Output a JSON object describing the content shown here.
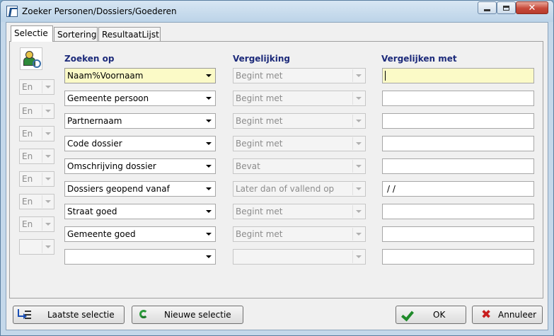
{
  "window": {
    "title": "Zoeker Personen/Dossiers/Goederen"
  },
  "tabs": [
    {
      "label": "Selectie",
      "active": true
    },
    {
      "label": "Sortering",
      "active": false
    },
    {
      "label": "ResultaatLijst",
      "active": false
    }
  ],
  "headers": {
    "field": "Zoeken op",
    "comparison": "Vergelijking",
    "value": "Vergelijken met"
  },
  "rows": [
    {
      "conj": "",
      "field": "Naam%Voornaam",
      "comparison": "Begint met",
      "value": ""
    },
    {
      "conj": "En",
      "field": "Gemeente persoon",
      "comparison": "Begint met",
      "value": ""
    },
    {
      "conj": "En",
      "field": "Partnernaam",
      "comparison": "Begint met",
      "value": ""
    },
    {
      "conj": "En",
      "field": "Code dossier",
      "comparison": "Begint met",
      "value": ""
    },
    {
      "conj": "En",
      "field": "Omschrijving dossier",
      "comparison": "Bevat",
      "value": ""
    },
    {
      "conj": "En",
      "field": "Dossiers geopend vanaf",
      "comparison": "Later dan of vallend op",
      "value": " /  /"
    },
    {
      "conj": "En",
      "field": "Straat goed",
      "comparison": "Begint met",
      "value": ""
    },
    {
      "conj": "En",
      "field": "Gemeente goed",
      "comparison": "Begint met",
      "value": ""
    },
    {
      "conj": "",
      "field": "",
      "comparison": "",
      "value": ""
    }
  ],
  "buttons": {
    "last_selection": "Laatste selectie",
    "new_selection": "Nieuwe selectie",
    "ok": "OK",
    "cancel": "Annuleer"
  },
  "colors": {
    "highlight": "#fbfac7",
    "header_text": "#1c2a7a"
  }
}
